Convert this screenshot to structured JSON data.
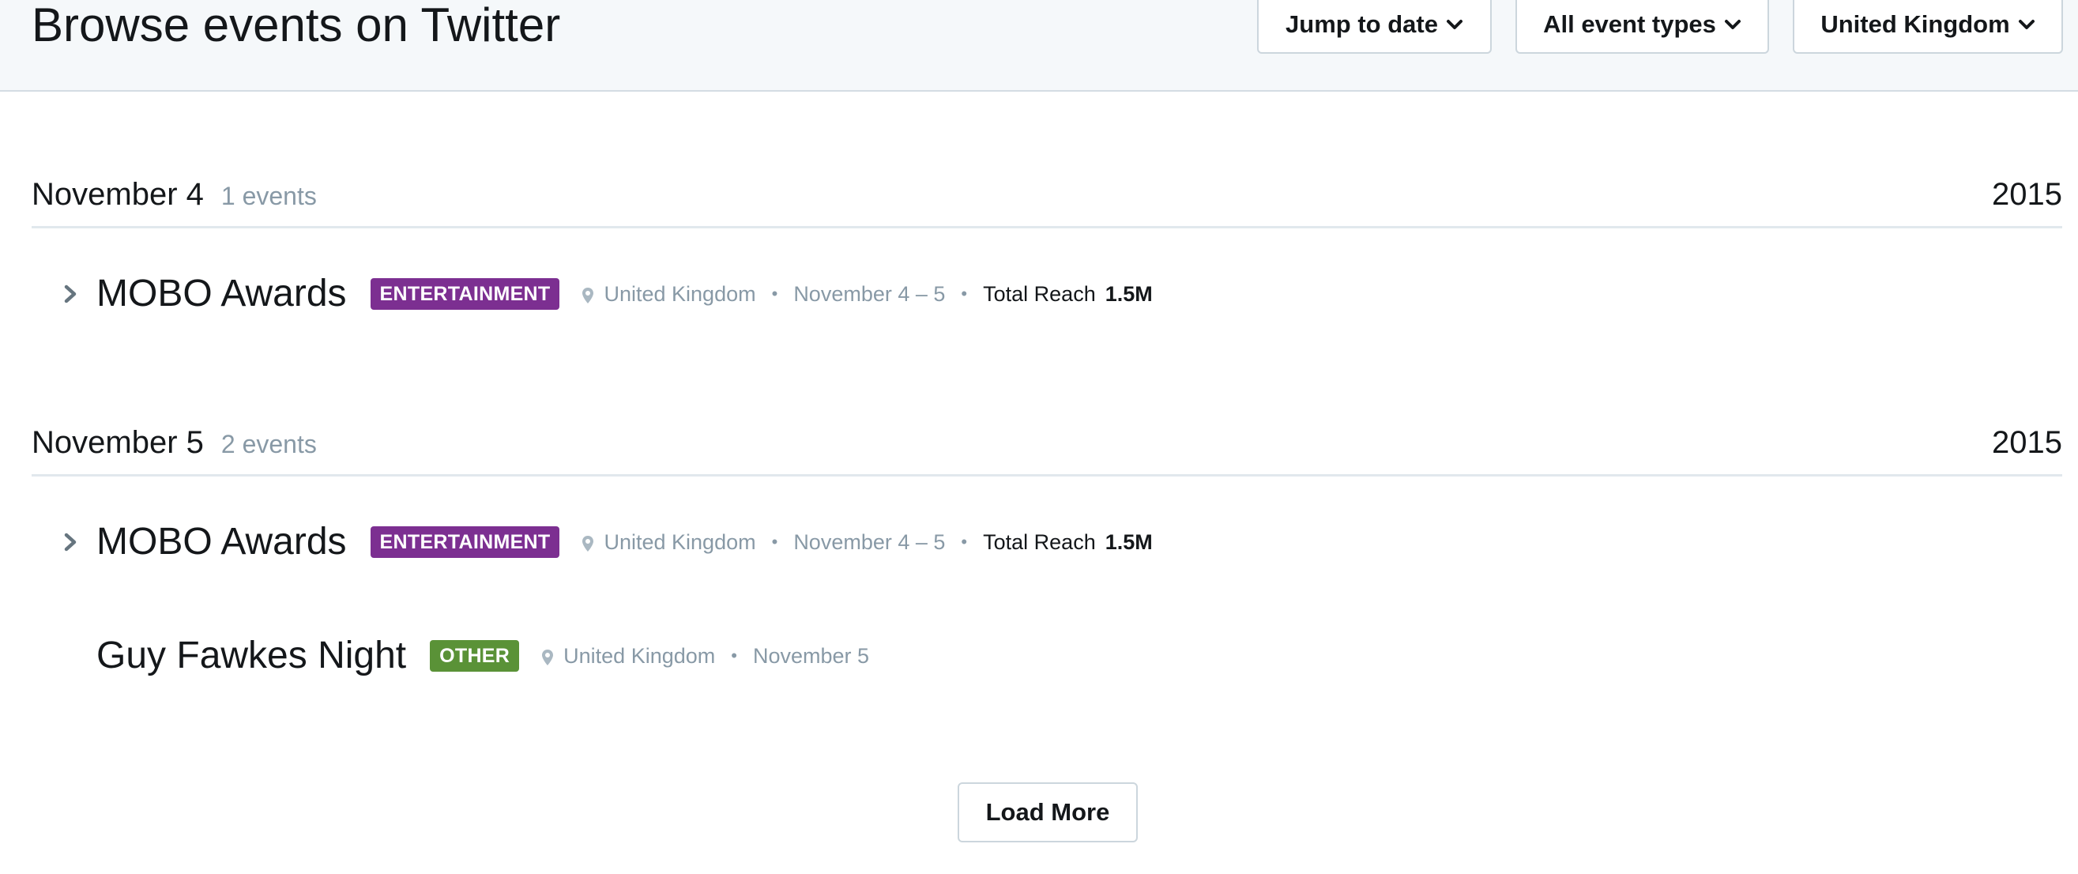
{
  "header": {
    "title": "Browse events on Twitter",
    "filters": [
      {
        "label": "Jump to date"
      },
      {
        "label": "All event types"
      },
      {
        "label": "United Kingdom"
      }
    ]
  },
  "days": [
    {
      "date": "November 4",
      "count": "1 events",
      "year": "2015",
      "events": [
        {
          "name": "MOBO Awards",
          "category": "ENTERTAINMENT",
          "location": "United Kingdom",
          "dates": "November 4 – 5",
          "reach_label": "Total Reach",
          "reach_value": "1.5M",
          "expandable": true
        }
      ]
    },
    {
      "date": "November 5",
      "count": "2 events",
      "year": "2015",
      "events": [
        {
          "name": "MOBO Awards",
          "category": "ENTERTAINMENT",
          "location": "United Kingdom",
          "dates": "November 4 – 5",
          "reach_label": "Total Reach",
          "reach_value": "1.5M",
          "expandable": true
        },
        {
          "name": "Guy Fawkes Night",
          "category": "OTHER",
          "location": "United Kingdom",
          "dates": "November 5",
          "expandable": false
        }
      ]
    }
  ],
  "load_more": "Load More",
  "colors": {
    "entertainment": "#7c2f91",
    "other": "#5a9237",
    "muted_text": "#8899a6",
    "header_bg": "#f5f8fa"
  },
  "icons": {
    "expand": "chevron-right-icon",
    "dropdown": "chevron-down-icon",
    "location": "map-pin-icon"
  }
}
